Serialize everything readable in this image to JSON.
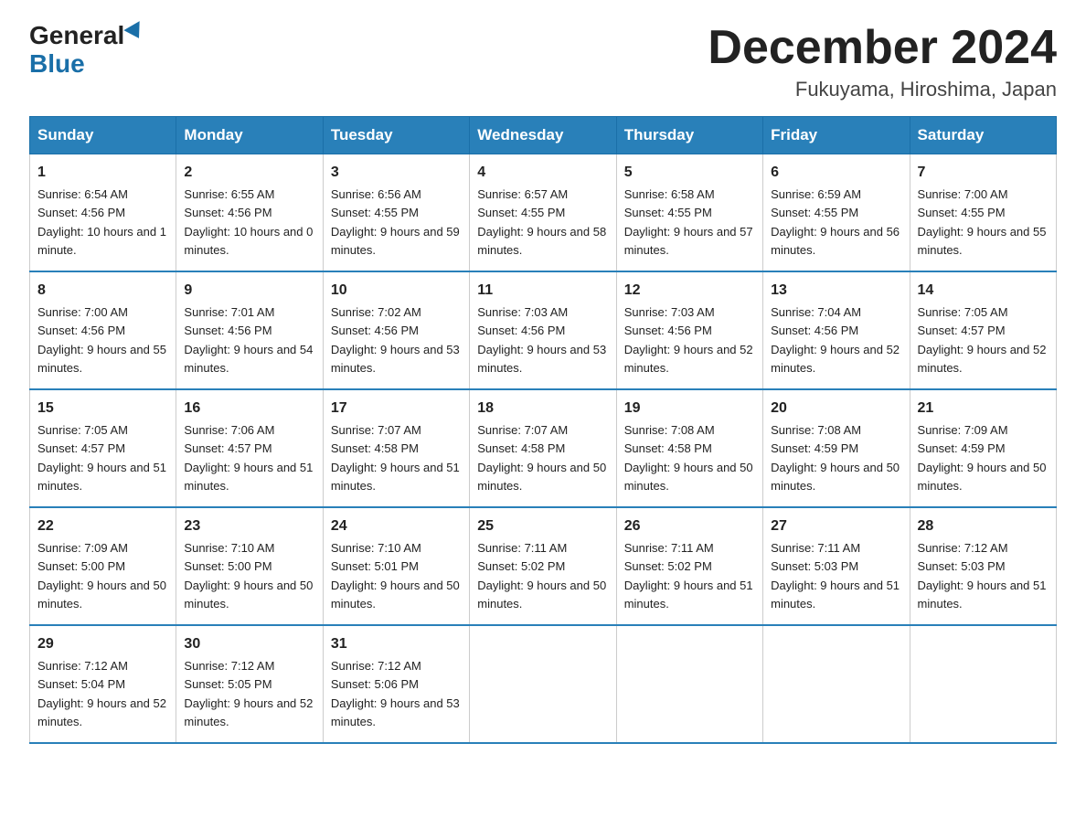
{
  "logo": {
    "general": "General",
    "blue": "Blue"
  },
  "header": {
    "month": "December 2024",
    "location": "Fukuyama, Hiroshima, Japan"
  },
  "days_of_week": [
    "Sunday",
    "Monday",
    "Tuesday",
    "Wednesday",
    "Thursday",
    "Friday",
    "Saturday"
  ],
  "weeks": [
    [
      {
        "day": "1",
        "sunrise": "6:54 AM",
        "sunset": "4:56 PM",
        "daylight": "10 hours and 1 minute."
      },
      {
        "day": "2",
        "sunrise": "6:55 AM",
        "sunset": "4:56 PM",
        "daylight": "10 hours and 0 minutes."
      },
      {
        "day": "3",
        "sunrise": "6:56 AM",
        "sunset": "4:55 PM",
        "daylight": "9 hours and 59 minutes."
      },
      {
        "day": "4",
        "sunrise": "6:57 AM",
        "sunset": "4:55 PM",
        "daylight": "9 hours and 58 minutes."
      },
      {
        "day": "5",
        "sunrise": "6:58 AM",
        "sunset": "4:55 PM",
        "daylight": "9 hours and 57 minutes."
      },
      {
        "day": "6",
        "sunrise": "6:59 AM",
        "sunset": "4:55 PM",
        "daylight": "9 hours and 56 minutes."
      },
      {
        "day": "7",
        "sunrise": "7:00 AM",
        "sunset": "4:55 PM",
        "daylight": "9 hours and 55 minutes."
      }
    ],
    [
      {
        "day": "8",
        "sunrise": "7:00 AM",
        "sunset": "4:56 PM",
        "daylight": "9 hours and 55 minutes."
      },
      {
        "day": "9",
        "sunrise": "7:01 AM",
        "sunset": "4:56 PM",
        "daylight": "9 hours and 54 minutes."
      },
      {
        "day": "10",
        "sunrise": "7:02 AM",
        "sunset": "4:56 PM",
        "daylight": "9 hours and 53 minutes."
      },
      {
        "day": "11",
        "sunrise": "7:03 AM",
        "sunset": "4:56 PM",
        "daylight": "9 hours and 53 minutes."
      },
      {
        "day": "12",
        "sunrise": "7:03 AM",
        "sunset": "4:56 PM",
        "daylight": "9 hours and 52 minutes."
      },
      {
        "day": "13",
        "sunrise": "7:04 AM",
        "sunset": "4:56 PM",
        "daylight": "9 hours and 52 minutes."
      },
      {
        "day": "14",
        "sunrise": "7:05 AM",
        "sunset": "4:57 PM",
        "daylight": "9 hours and 52 minutes."
      }
    ],
    [
      {
        "day": "15",
        "sunrise": "7:05 AM",
        "sunset": "4:57 PM",
        "daylight": "9 hours and 51 minutes."
      },
      {
        "day": "16",
        "sunrise": "7:06 AM",
        "sunset": "4:57 PM",
        "daylight": "9 hours and 51 minutes."
      },
      {
        "day": "17",
        "sunrise": "7:07 AM",
        "sunset": "4:58 PM",
        "daylight": "9 hours and 51 minutes."
      },
      {
        "day": "18",
        "sunrise": "7:07 AM",
        "sunset": "4:58 PM",
        "daylight": "9 hours and 50 minutes."
      },
      {
        "day": "19",
        "sunrise": "7:08 AM",
        "sunset": "4:58 PM",
        "daylight": "9 hours and 50 minutes."
      },
      {
        "day": "20",
        "sunrise": "7:08 AM",
        "sunset": "4:59 PM",
        "daylight": "9 hours and 50 minutes."
      },
      {
        "day": "21",
        "sunrise": "7:09 AM",
        "sunset": "4:59 PM",
        "daylight": "9 hours and 50 minutes."
      }
    ],
    [
      {
        "day": "22",
        "sunrise": "7:09 AM",
        "sunset": "5:00 PM",
        "daylight": "9 hours and 50 minutes."
      },
      {
        "day": "23",
        "sunrise": "7:10 AM",
        "sunset": "5:00 PM",
        "daylight": "9 hours and 50 minutes."
      },
      {
        "day": "24",
        "sunrise": "7:10 AM",
        "sunset": "5:01 PM",
        "daylight": "9 hours and 50 minutes."
      },
      {
        "day": "25",
        "sunrise": "7:11 AM",
        "sunset": "5:02 PM",
        "daylight": "9 hours and 50 minutes."
      },
      {
        "day": "26",
        "sunrise": "7:11 AM",
        "sunset": "5:02 PM",
        "daylight": "9 hours and 51 minutes."
      },
      {
        "day": "27",
        "sunrise": "7:11 AM",
        "sunset": "5:03 PM",
        "daylight": "9 hours and 51 minutes."
      },
      {
        "day": "28",
        "sunrise": "7:12 AM",
        "sunset": "5:03 PM",
        "daylight": "9 hours and 51 minutes."
      }
    ],
    [
      {
        "day": "29",
        "sunrise": "7:12 AM",
        "sunset": "5:04 PM",
        "daylight": "9 hours and 52 minutes."
      },
      {
        "day": "30",
        "sunrise": "7:12 AM",
        "sunset": "5:05 PM",
        "daylight": "9 hours and 52 minutes."
      },
      {
        "day": "31",
        "sunrise": "7:12 AM",
        "sunset": "5:06 PM",
        "daylight": "9 hours and 53 minutes."
      },
      null,
      null,
      null,
      null
    ]
  ]
}
